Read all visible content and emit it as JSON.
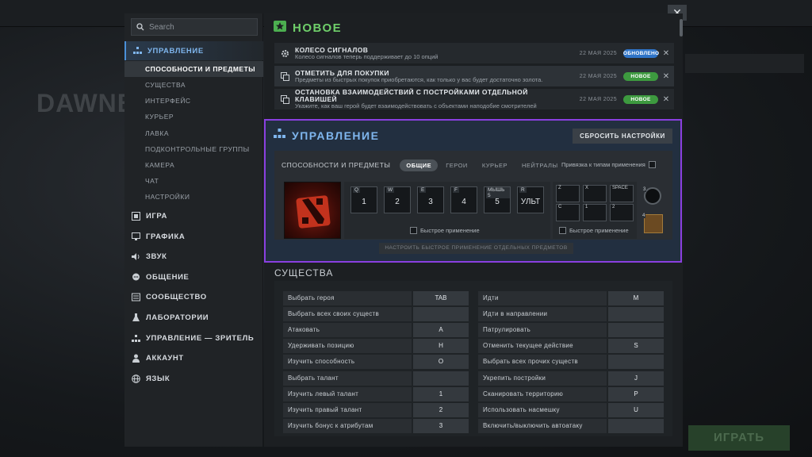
{
  "background": {
    "hero_name": "DAWNB",
    "play_label": "ИГРАТЬ"
  },
  "search": {
    "placeholder": "Search"
  },
  "sidebar": {
    "categories": [
      {
        "label": "УПРАВЛЕНИЕ",
        "icon": "controls-icon"
      },
      {
        "label": "ИГРА",
        "icon": "game-icon"
      },
      {
        "label": "ГРАФИКА",
        "icon": "monitor-icon"
      },
      {
        "label": "ЗВУК",
        "icon": "speaker-icon"
      },
      {
        "label": "ОБЩЕНИЕ",
        "icon": "chat-icon"
      },
      {
        "label": "СООБЩЕСТВО",
        "icon": "community-icon"
      },
      {
        "label": "ЛАБОРАТОРИИ",
        "icon": "flask-icon"
      },
      {
        "label": "УПРАВЛЕНИЕ — ЗРИТЕЛЬ",
        "icon": "eye-icon"
      },
      {
        "label": "АККАУНТ",
        "icon": "user-icon"
      },
      {
        "label": "ЯЗЫК",
        "icon": "globe-icon"
      }
    ],
    "subitems": [
      "СПОСОБНОСТИ И ПРЕДМЕТЫ",
      "СУЩЕСТВА",
      "ИНТЕРФЕЙС",
      "КУРЬЕР",
      "ЛАВКА",
      "ПОДКОНТРОЛЬНЫЕ ГРУППЫ",
      "КАМЕРА",
      "ЧАТ",
      "НАСТРОЙКИ"
    ]
  },
  "news": {
    "title": "НОВОЕ",
    "items": [
      {
        "title": "КОЛЕСО СИГНАЛОВ",
        "desc": "Колесо сигналов теперь поддерживает до 10 опций",
        "date": "22 МАЯ 2025",
        "badge": "ОБНОВЛЕНО",
        "badge_color": "#2f74c8"
      },
      {
        "title": "ОТМЕТИТЬ ДЛЯ ПОКУПКИ",
        "desc": "Предметы из быстрых покупок приобретаются, как только у вас будет достаточно золота.",
        "date": "22 МАЯ 2025",
        "badge": "НОВОЕ",
        "badge_color": "#3d9a3f"
      },
      {
        "title": "ОСТАНОВКА ВЗАИМОДЕЙСТВИЙ С ПОСТРОЙКАМИ ОТДЕЛЬНОЙ КЛАВИШЕЙ",
        "desc": "Укажите, как ваш герой будет взаимодействовать с объектами наподобие смотрителей",
        "date": "22 МАЯ 2025",
        "badge": "НОВОЕ",
        "badge_color": "#3d9a3f"
      }
    ]
  },
  "control": {
    "title": "УПРАВЛЕНИЕ",
    "reset_label": "СБРОСИТЬ НАСТРОЙКИ",
    "section_label": "СПОСОБНОСТИ И ПРЕДМЕТЫ",
    "tabs": [
      "ОБЩИЕ",
      "ГЕРОИ",
      "КУРЬЕР",
      "НЕЙТРАЛЫ"
    ],
    "active_tab": "ОБЩИЕ",
    "bind_type_label": "Привязка к типам применения",
    "ability_slots": [
      {
        "key": "Q",
        "value": "1"
      },
      {
        "key": "W",
        "value": "2"
      },
      {
        "key": "E",
        "value": "3"
      },
      {
        "key": "F",
        "value": "4"
      },
      {
        "key": "МЫШЬ 5",
        "value": "5"
      },
      {
        "key": "R",
        "value": "УЛЬТ"
      }
    ],
    "item_slots": [
      "Z",
      "X",
      "SPACE",
      "C",
      "1",
      "2"
    ],
    "tp_key": "3",
    "neutral_key": "4",
    "quick_cast_label": "Быстрое применение",
    "configure_items_label": "НАСТРОИТЬ БЫСТРОЕ ПРИМЕНЕНИЕ ОТДЕЛЬНЫХ ПРЕДМЕТОВ"
  },
  "units": {
    "title": "СУЩЕСТВА",
    "left": [
      {
        "action": "Выбрать героя",
        "key": "TAB"
      },
      {
        "action": "Выбрать всех своих существ",
        "key": ""
      },
      {
        "action": "Атаковать",
        "key": "A"
      },
      {
        "action": "Удерживать позицию",
        "key": "H"
      },
      {
        "action": "Изучить способность",
        "key": "O"
      },
      {
        "action": "Выбрать талант",
        "key": ""
      },
      {
        "action": "Изучить левый талант",
        "key": "1"
      },
      {
        "action": "Изучить правый талант",
        "key": "2"
      },
      {
        "action": "Изучить бонус к атрибутам",
        "key": "3"
      }
    ],
    "right": [
      {
        "action": "Идти",
        "key": "M"
      },
      {
        "action": "Идти в направлении",
        "key": ""
      },
      {
        "action": "Патрулировать",
        "key": ""
      },
      {
        "action": "Отменить текущее действие",
        "key": "S"
      },
      {
        "action": "Выбрать всех прочих существ",
        "key": ""
      },
      {
        "action": "Укрепить постройки",
        "key": "J"
      },
      {
        "action": "Сканировать территорию",
        "key": "P"
      },
      {
        "action": "Использовать насмешку",
        "key": "U"
      },
      {
        "action": "Включить/выключить автоатаку",
        "key": ""
      }
    ]
  },
  "colors": {
    "accent_blue": "#7fb6ee",
    "accent_green": "#6fcf6a",
    "highlight_purple": "#8a3fe0"
  }
}
